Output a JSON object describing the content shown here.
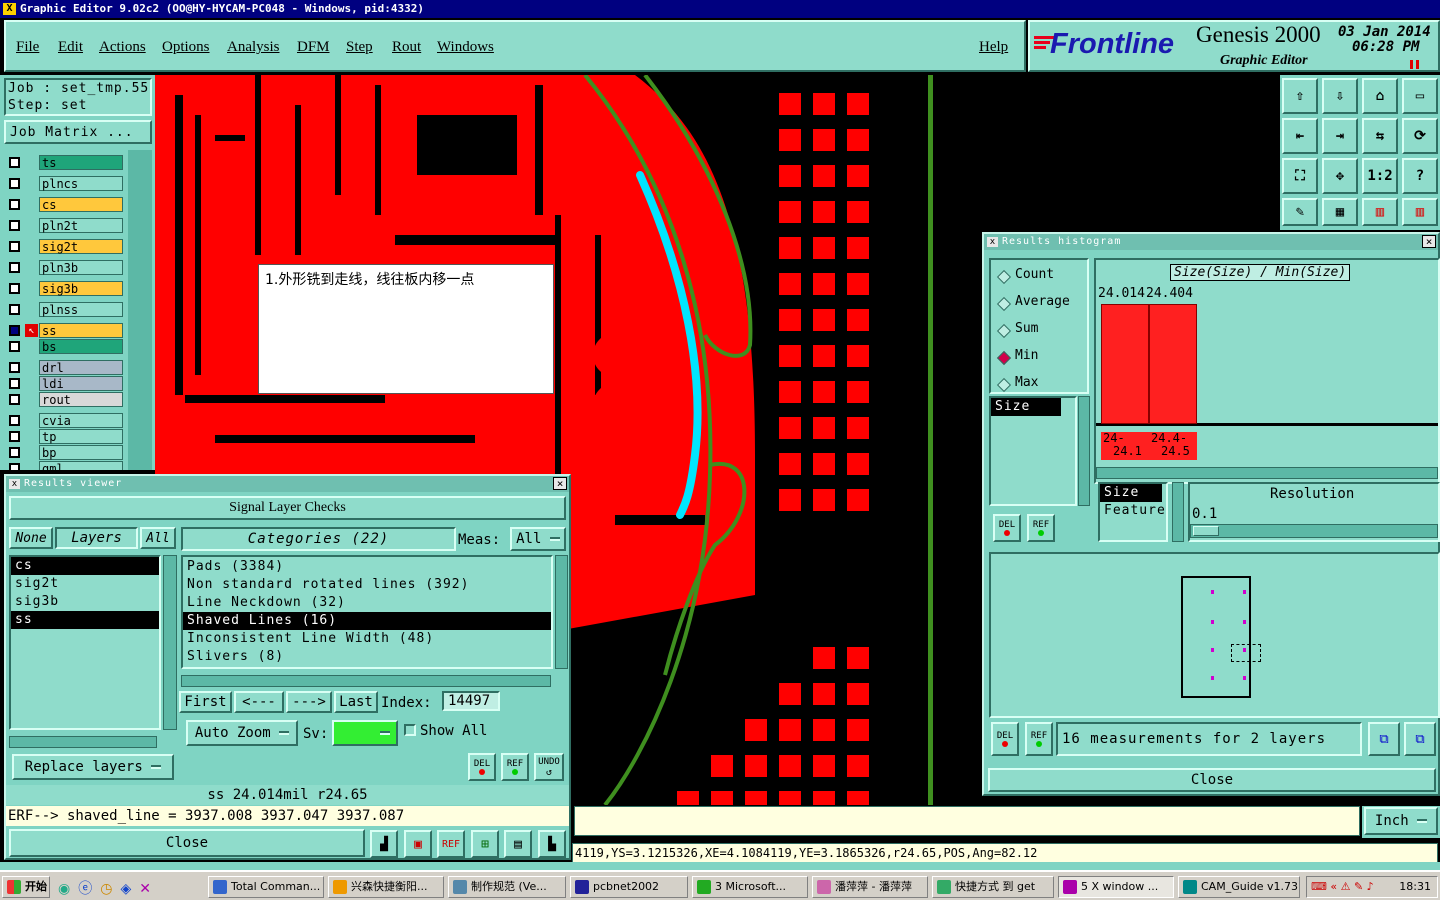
{
  "window_title": "Graphic Editor 9.02c2  (OO@HY-HYCAM-PC048 - Windows, pid:4332)",
  "menu": [
    "File",
    "Edit",
    "Actions",
    "Options",
    "Analysis",
    "DFM",
    "Step",
    "Rout",
    "Windows"
  ],
  "help_label": "Help",
  "brand": {
    "company": "Frontline",
    "product": "Genesis 2000",
    "subtitle": "Graphic Editor",
    "date": "03 Jan 2014",
    "time": "06:28 PM"
  },
  "job": {
    "job_label": "Job : set_tmp.55",
    "step_label": "Step: set",
    "matrix_button": "Job Matrix ..."
  },
  "layers": [
    {
      "name": "ts",
      "color": "#1fa57a"
    },
    {
      "name": "plncs",
      "color": "#8fdccb"
    },
    {
      "name": "cs",
      "color": "#ffc83c"
    },
    {
      "name": "pln2t",
      "color": "#8fdccb"
    },
    {
      "name": "sig2t",
      "color": "#ffc83c"
    },
    {
      "name": "pln3b",
      "color": "#8fdccb"
    },
    {
      "name": "sig3b",
      "color": "#ffc83c"
    },
    {
      "name": "plnss",
      "color": "#8fdccb"
    },
    {
      "name": "ss",
      "color": "#ffc83c"
    },
    {
      "name": "bs",
      "color": "#1fa57a"
    },
    {
      "name": "drl",
      "color": "#a8b8c8"
    },
    {
      "name": "ldi",
      "color": "#a8b8c8"
    },
    {
      "name": "rout",
      "color": "#d8d8d8"
    },
    {
      "name": "cvia",
      "color": "#8fdccb"
    },
    {
      "name": "tp",
      "color": "#8fdccb"
    },
    {
      "name": "bp",
      "color": "#8fdccb"
    },
    {
      "name": "gml",
      "color": "#8fdccb"
    }
  ],
  "annotation_note": "1.外形铣到走线，线往板内移一点",
  "results_viewer": {
    "title": "Results viewer",
    "header": "Signal Layer Checks",
    "none_btn": "None",
    "layers_label": "Layers",
    "all_btn": "All",
    "layers": [
      "cs",
      "sig2t",
      "sig3b",
      "ss"
    ],
    "categories_label": "Categories (22)",
    "meas_label": "Meas:",
    "meas_value": "All",
    "categories": [
      "Pads (3384)",
      "Non standard rotated lines (392)",
      "Line Neckdown (32)",
      "Shaved Lines (16)",
      "Inconsistent Line Width (48)",
      "Slivers (8)"
    ],
    "selected_category": "Shaved Lines (16)",
    "first_btn": "First",
    "prev_btn": "<---",
    "next_btn": "--->",
    "last_btn": "Last",
    "index_label": "Index:",
    "index_value": "14497",
    "auto_zoom": "Auto Zoom",
    "sv_label": "Sv:",
    "show_all": "Show All",
    "replace_layers": "Replace layers",
    "del_btn": "DEL",
    "ref_btn": "REF",
    "undo_btn": "UNDO",
    "measure_line": "ss 24.014mil  r24.65",
    "erf_line": "ERF--> shaved_line = 3937.008 3937.047 3937.087",
    "close": "Close"
  },
  "histogram": {
    "title": "Results histogram",
    "options": [
      "Count",
      "Average",
      "Sum",
      "Min",
      "Max"
    ],
    "selected_option": "Min",
    "list_item": "Size",
    "chart_title": "Size(Size) / Min(Size)",
    "bar_labels": [
      "24.014",
      "24.404"
    ],
    "bin_labels": [
      [
        "24-",
        "24.1"
      ],
      [
        "24.4-",
        "24.5"
      ]
    ],
    "field_items": [
      "Size",
      "Feature"
    ],
    "resolution_label": "Resolution",
    "resolution_value": "0.1",
    "del_btn": "DEL",
    "ref_btn": "REF",
    "summary": "16 measurements for 2 layers",
    "close": "Close"
  },
  "units": "Inch",
  "status_line": "4119,YS=3.1215326,XE=4.1084119,YE=3.1865326,r24.65,POS,Ang=82.12",
  "taskbar": {
    "start": "开始",
    "tasks": [
      "Total Comman...",
      "兴森快捷衡阳...",
      "制作规范 (Ve...",
      "pcbnet2002",
      "3 Microsoft...",
      "潘萍萍 - 潘萍萍",
      "快捷方式 到 get",
      "5 X window ...",
      "CAM_Guide v1.73"
    ],
    "clock": "18:31"
  },
  "colors": {
    "accent": "#7fd4c3",
    "copper": "#ff0000",
    "highlight": "#00e5ff",
    "rout_line": "#3f8f1f"
  }
}
